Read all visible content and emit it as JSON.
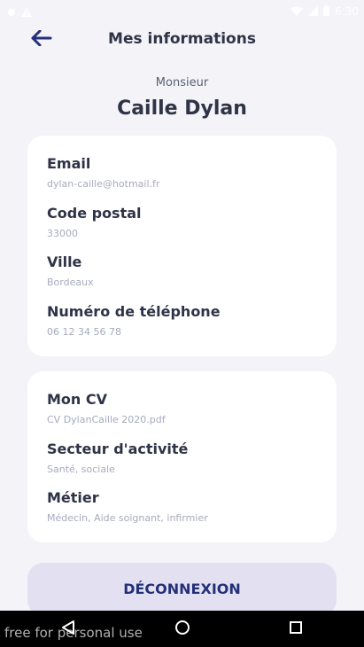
{
  "status_bar": {
    "time": "6:30",
    "icons": [
      "notification-dot-icon",
      "warning-icon",
      "wifi-icon",
      "signal-icon",
      "battery-icon"
    ]
  },
  "header": {
    "back_icon": "arrow-left-icon",
    "title": "Mes informations"
  },
  "profile": {
    "civility": "Monsieur",
    "name": "Caille Dylan"
  },
  "personal_card": {
    "fields": [
      {
        "label": "Email",
        "value": "dylan-caille@hotmail.fr"
      },
      {
        "label": "Code postal",
        "value": "33000"
      },
      {
        "label": "Ville",
        "value": "Bordeaux"
      },
      {
        "label": "Numéro de téléphone",
        "value": "06 12 34 56 78"
      }
    ]
  },
  "pro_card": {
    "fields": [
      {
        "label": "Mon CV",
        "value": "CV DylanCaille 2020.pdf"
      },
      {
        "label": "Secteur d'activité",
        "value": "Santé, sociale"
      },
      {
        "label": "Métier",
        "value": "Médecin, Aide soignant, infirmier"
      }
    ]
  },
  "logout": {
    "label": "DÉCONNEXION"
  },
  "nav_bar": {
    "watermark": "free for personal use",
    "buttons": [
      "back-triangle-icon",
      "home-circle-icon",
      "recents-square-icon"
    ]
  },
  "colors": {
    "background": "#f4f3f8",
    "card": "#ffffff",
    "title_text": "#2f3347",
    "value_text": "#a7aabd",
    "accent": "#24307a",
    "logout_bg": "#e3e1f1"
  }
}
